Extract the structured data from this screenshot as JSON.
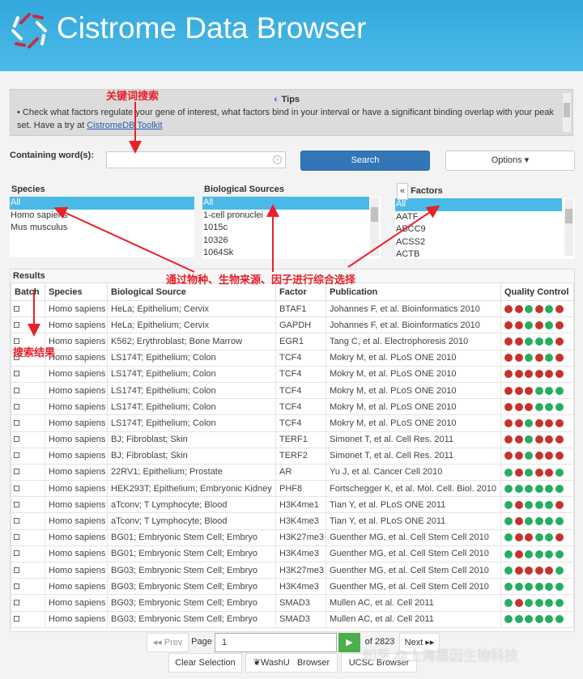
{
  "header": {
    "title": "Cistrome Data Browser"
  },
  "tips": {
    "title": "Tips",
    "text": "• Check what factors regulate your gene of interest, what factors bind in your interval or have a significant binding overlap with your peak set. Have a try at ",
    "link": "CistromeDB Toolkit"
  },
  "search": {
    "label": "Containing word(s):",
    "value": "",
    "button": "Search",
    "options": "Options ▾"
  },
  "species": {
    "title": "Species",
    "items": [
      "All",
      "Homo sapiens",
      "Mus musculus"
    ]
  },
  "sources": {
    "title": "Biological Sources",
    "items": [
      "All",
      "1-cell pronuclei",
      "1015c",
      "10326",
      "1064Sk"
    ]
  },
  "factors": {
    "title": "Factors",
    "collapse": "«",
    "items": [
      "All",
      "AATF",
      "ABCC9",
      "ACSS2",
      "ACTB"
    ]
  },
  "results": {
    "title": "Results",
    "columns": [
      "Batch",
      "Species",
      "Biological Source",
      "Factor",
      "Publication",
      "Quality Control"
    ],
    "rows": [
      [
        "Homo sapiens",
        "HeLa; Epithelium; Cervix",
        "BTAF1",
        "Johannes F, et al. Bioinformatics 2010",
        "RRGRGR"
      ],
      [
        "Homo sapiens",
        "HeLa; Epithelium; Cervix",
        "GAPDH",
        "Johannes F, et al. Bioinformatics 2010",
        "RRGRGR"
      ],
      [
        "Homo sapiens",
        "K562; Erythroblast; Bone Marrow",
        "EGR1",
        "Tang C, et al. Electrophoresis 2010",
        "RRGGGR"
      ],
      [
        "Homo sapiens",
        "LS174T; Epithelium; Colon",
        "TCF4",
        "Mokry M, et al. PLoS ONE 2010",
        "RRGRGR"
      ],
      [
        "Homo sapiens",
        "LS174T; Epithelium; Colon",
        "TCF4",
        "Mokry M, et al. PLoS ONE 2010",
        "RRRRRR"
      ],
      [
        "Homo sapiens",
        "LS174T; Epithelium; Colon",
        "TCF4",
        "Mokry M, et al. PLoS ONE 2010",
        "RRRGGG"
      ],
      [
        "Homo sapiens",
        "LS174T; Epithelium; Colon",
        "TCF4",
        "Mokry M, et al. PLoS ONE 2010",
        "RRRGGG"
      ],
      [
        "Homo sapiens",
        "LS174T; Epithelium; Colon",
        "TCF4",
        "Mokry M, et al. PLoS ONE 2010",
        "RRGRRR"
      ],
      [
        "Homo sapiens",
        "BJ; Fibroblast; Skin",
        "TERF1",
        "Simonet T, et al. Cell Res. 2011",
        "RRGRRR"
      ],
      [
        "Homo sapiens",
        "BJ; Fibroblast; Skin",
        "TERF2",
        "Simonet T, et al. Cell Res. 2011",
        "RRGRRR"
      ],
      [
        "Homo sapiens",
        "22RV1; Epithelium; Prostate",
        "AR",
        "Yu J, et al. Cancer Cell 2010",
        "GRGRRG"
      ],
      [
        "Homo sapiens",
        "HEK293T; Epithelium; Embryonic Kidney",
        "PHF8",
        "Fortschegger K, et al. Mol. Cell. Biol. 2010",
        "GGGGGG"
      ],
      [
        "Homo sapiens",
        "aTconv; T Lymphocyte; Blood",
        "H3K4me1",
        "Tian Y, et al. PLoS ONE 2011",
        "GRGGGR"
      ],
      [
        "Homo sapiens",
        "aTconv; T Lymphocyte; Blood",
        "H3K4me3",
        "Tian Y, et al. PLoS ONE 2011",
        "GRGGGG"
      ],
      [
        "Homo sapiens",
        "BG01; Embryonic Stem Cell; Embryo",
        "H3K27me3",
        "Guenther MG, et al. Cell Stem Cell 2010",
        "GRRGGR"
      ],
      [
        "Homo sapiens",
        "BG01; Embryonic Stem Cell; Embryo",
        "H3K4me3",
        "Guenther MG, et al. Cell Stem Cell 2010",
        "GRGGGG"
      ],
      [
        "Homo sapiens",
        "BG03; Embryonic Stem Cell; Embryo",
        "H3K27me3",
        "Guenther MG, et al. Cell Stem Cell 2010",
        "GRRRRG"
      ],
      [
        "Homo sapiens",
        "BG03; Embryonic Stem Cell; Embryo",
        "H3K4me3",
        "Guenther MG, et al. Cell Stem Cell 2010",
        "GGGGGG"
      ],
      [
        "Homo sapiens",
        "BG03; Embryonic Stem Cell; Embryo",
        "SMAD3",
        "Mullen AC, et al. Cell 2011",
        "GRGGGG"
      ],
      [
        "Homo sapiens",
        "BG03; Embryonic Stem Cell; Embryo",
        "SMAD3",
        "Mullen AC, et al. Cell 2011",
        "GGGGGG"
      ]
    ]
  },
  "pager": {
    "prev": "◂◂ Prev",
    "page_label": "Page",
    "page": "1",
    "of": "of 2823",
    "next": "Next ▸▸",
    "clear": "Clear Selection",
    "washu": "WashU   Browser",
    "ucsc": "UCSC Browser"
  },
  "annotations": {
    "keyword": "关键词搜索",
    "filter": "通过物种、生物来源、因子进行综合选择",
    "results": "搜索结果"
  },
  "watermark": "知乎 @上海嘉因生物科技",
  "colors": {
    "red": "#c8322c",
    "green": "#27ad5f"
  }
}
